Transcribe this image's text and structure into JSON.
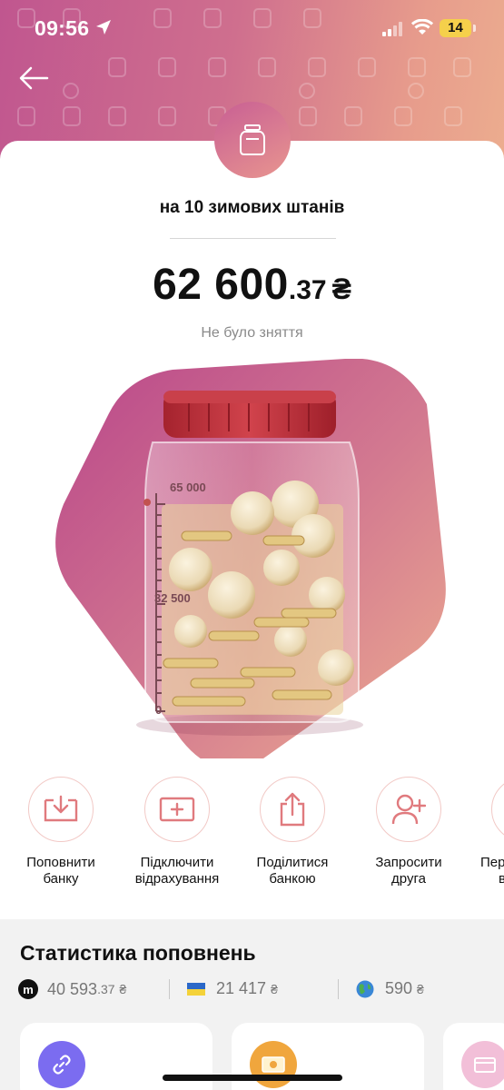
{
  "status_bar": {
    "time": "09:56",
    "battery": "14"
  },
  "goal": {
    "name": "на 10 зимових штанів"
  },
  "balance": {
    "integer": "62 600",
    "decimal": ".37",
    "currency": "₴"
  },
  "withdraw_status": "Не було зняття",
  "jar_scale": {
    "max": "65 000",
    "mid": "32 500",
    "min": "0",
    "fill_fraction": 0.963
  },
  "actions": [
    {
      "label_line1": "Поповнити",
      "label_line2": "банку",
      "icon": "deposit-icon"
    },
    {
      "label_line1": "Підключити",
      "label_line2": "відрахування",
      "icon": "add-card-icon"
    },
    {
      "label_line1": "Поділитися",
      "label_line2": "банкою",
      "icon": "share-icon"
    },
    {
      "label_line1": "Запросити",
      "label_line2": "друга",
      "icon": "add-user-icon"
    },
    {
      "label_line1": "Пер",
      "label_line2": "в",
      "icon": "more-icon"
    }
  ],
  "stats": {
    "title": "Статистика поповнень",
    "items": [
      {
        "icon": "monobank-icon",
        "icon_letter": "m",
        "integer": "40 593",
        "decimal": ".37",
        "currency": "₴"
      },
      {
        "icon": "ukraine-flag-icon",
        "integer": "21 417",
        "decimal": "",
        "currency": "₴"
      },
      {
        "icon": "globe-icon",
        "integer": "590",
        "decimal": "",
        "currency": "₴"
      }
    ]
  },
  "colors": {
    "header_gradient_start": "#c0568f",
    "header_gradient_end": "#ecad8f",
    "accent": "#e07a7e",
    "link_card": "#7b6cf0",
    "money_card": "#f0a63d",
    "card_card": "#f2bfd8"
  }
}
